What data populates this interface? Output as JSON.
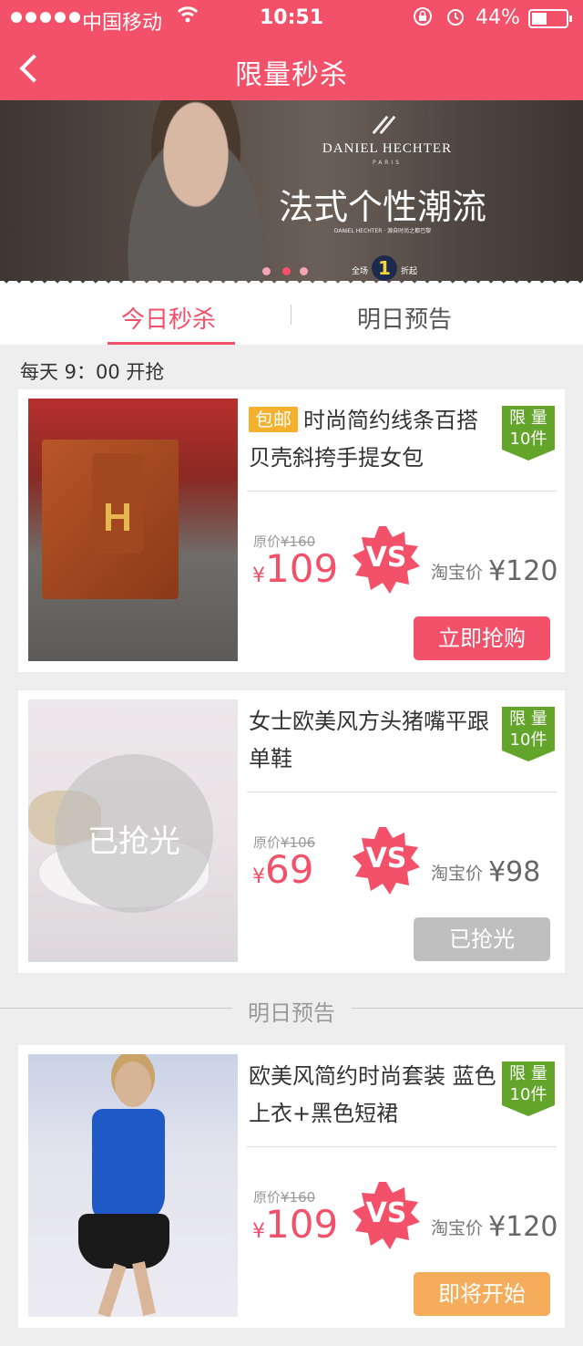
{
  "status_bar": {
    "carrier": "中国移动",
    "time": "10:51",
    "battery": "44%"
  },
  "nav": {
    "title": "限量秒杀"
  },
  "banner": {
    "brand": "DANIEL HECHTER",
    "brand_sub": "PARIS",
    "slogan": "法式个性潮流",
    "sub_slogan": "DANIEL HECHTER · 源自时尚之都巴黎",
    "promo_prefix": "全场",
    "promo_number": "1",
    "promo_suffix": "折起",
    "active_dot": 1
  },
  "tabs": {
    "today": "今日秒杀",
    "tomorrow": "明日预告"
  },
  "daily_time": "每天 9：00 开抢",
  "products": [
    {
      "tag": "包邮",
      "title": "时尚简约线条百搭贝壳斜挎手提女包",
      "limit_line1": "限 量",
      "limit_line2": "10件",
      "orig_label": "原价",
      "orig_price": "¥160",
      "currency": "¥",
      "price": "109",
      "vs": "VS",
      "taobao_label": "淘宝价",
      "taobao_price": "¥120",
      "button": "立即抢购"
    },
    {
      "title": "女士欧美风方头猪嘴平跟单鞋",
      "sold_out_overlay": "已抢光",
      "limit_line1": "限 量",
      "limit_line2": "10件",
      "orig_label": "原价",
      "orig_price": "¥106",
      "currency": "¥",
      "price": "69",
      "vs": "VS",
      "taobao_label": "淘宝价",
      "taobao_price": "¥98",
      "button": "已抢光"
    },
    {
      "title": "欧美风简约时尚套装 蓝色上衣+黑色短裙",
      "limit_line1": "限 量",
      "limit_line2": "10件",
      "orig_label": "原价",
      "orig_price": "¥160",
      "currency": "¥",
      "price": "109",
      "vs": "VS",
      "taobao_label": "淘宝价",
      "taobao_price": "¥120",
      "button": "即将开始"
    }
  ],
  "tomorrow_divider": "明日预告",
  "colors": {
    "brand": "#f3506a",
    "limit_badge": "#62a52a",
    "tag": "#f5b12e",
    "button_disabled": "#bfbfbf",
    "button_upcoming": "#f6ad5b"
  }
}
